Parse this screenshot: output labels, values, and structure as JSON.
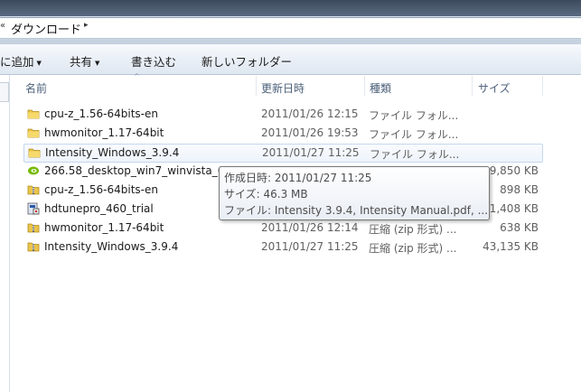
{
  "address": {
    "chevron_left": "«",
    "crumb": "ダウンロード",
    "chevron_right": "▸"
  },
  "toolbar": {
    "add_to": "に追加",
    "share": "共有",
    "burn": "書き込む",
    "new_folder": "新しいフォルダー",
    "dropdown_glyph": "▼"
  },
  "columns": {
    "name": "名前",
    "modified": "更新日時",
    "type": "種類",
    "size": "サイズ",
    "sort_glyph": "^"
  },
  "files": [
    {
      "icon": "folder-icon",
      "name": "cpu-z_1.56-64bits-en",
      "date": "2011/01/26 12:15",
      "type": "ファイル フォル...",
      "size": ""
    },
    {
      "icon": "folder-icon",
      "name": "hwmonitor_1.17-64bit",
      "date": "2011/01/26 19:53",
      "type": "ファイル フォル...",
      "size": ""
    },
    {
      "icon": "folder-icon",
      "name": "Intensity_Windows_3.9.4",
      "date": "2011/01/27 11:25",
      "type": "ファイル フォル...",
      "size": ""
    },
    {
      "icon": "nvidia-installer-icon",
      "name": "266.58_desktop_win7_winvista_6",
      "date": "",
      "type": "",
      "size": "9,850 KB"
    },
    {
      "icon": "zip-archive-icon",
      "name": "cpu-z_1.56-64bits-en",
      "date": "",
      "type": "",
      "size": "898 KB"
    },
    {
      "icon": "setup-exe-icon",
      "name": "hdtunepro_460_trial",
      "date": "",
      "type": "",
      "size": "1,408 KB"
    },
    {
      "icon": "zip-archive-icon",
      "name": "hwmonitor_1.17-64bit",
      "date": "2011/01/26 12:14",
      "type": "圧縮 (zip 形式) ...",
      "size": "638 KB"
    },
    {
      "icon": "zip-archive-icon",
      "name": "Intensity_Windows_3.9.4",
      "date": "2011/01/27 11:25",
      "type": "圧縮 (zip 形式) ...",
      "size": "43,135 KB"
    }
  ],
  "tooltip": {
    "created": "作成日時: 2011/01/27 11:25",
    "size": "サイズ: 46.3 MB",
    "files": "ファイル: Intensity 3.9.4, Intensity Manual.pdf, ..."
  },
  "colors": {
    "folder": "#e9c54a",
    "selection_border": "#c4d7ef",
    "header_text": "#4c607a"
  }
}
